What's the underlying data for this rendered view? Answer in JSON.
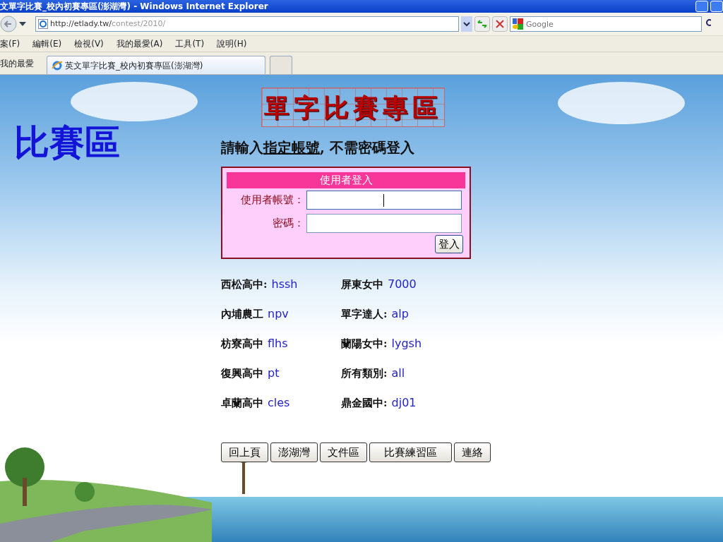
{
  "window": {
    "title": "文單字比賽_校內初賽專區(澎湖灣) - Windows Internet Explorer"
  },
  "address_bar": {
    "url_host": "http://etlady.tw/",
    "url_path": "contest/2010/"
  },
  "search_box": {
    "placeholder": "Google"
  },
  "menu": [
    "案(F)",
    "編輯(E)",
    "檢視(V)",
    "我的最愛(A)",
    "工具(T)",
    "說明(H)"
  ],
  "favorites": {
    "label": "我的最愛"
  },
  "tabs": [
    {
      "label": "英文單字比賽_校內初賽專區(澎湖灣)",
      "selected": true
    }
  ],
  "page": {
    "side_title": "比賽區",
    "banner": "單字比賽專區",
    "instruction": [
      {
        "text": "請輸入",
        "underline": false
      },
      {
        "text": "指定帳號",
        "underline": true
      },
      {
        "text": ", 不需密碼登入",
        "underline": false
      }
    ],
    "login": {
      "header": "使用者登入",
      "fields": [
        {
          "label": "使用者帳號：",
          "focused": true
        },
        {
          "label": "密碼：",
          "focused": false
        }
      ],
      "submit": "登入"
    },
    "accounts": [
      {
        "school": "西松高中:",
        "code": "hssh"
      },
      {
        "school": "屏東女中",
        "code": "7000"
      },
      {
        "school": "內埔農工",
        "code": "npv"
      },
      {
        "school": "單字達人:",
        "code": "alp"
      },
      {
        "school": "枋寮高中",
        "code": "flhs"
      },
      {
        "school": "蘭陽女中:",
        "code": "lygsh"
      },
      {
        "school": "復興高中",
        "code": "pt"
      },
      {
        "school": "所有類別:",
        "code": "all"
      },
      {
        "school": "卓蘭高中",
        "code": "cles"
      },
      {
        "school": "鼎金國中:",
        "code": "dj01"
      }
    ],
    "nav_buttons": [
      "回上頁",
      "澎湖灣",
      "文件區",
      "比賽練習區",
      "連絡"
    ]
  }
}
